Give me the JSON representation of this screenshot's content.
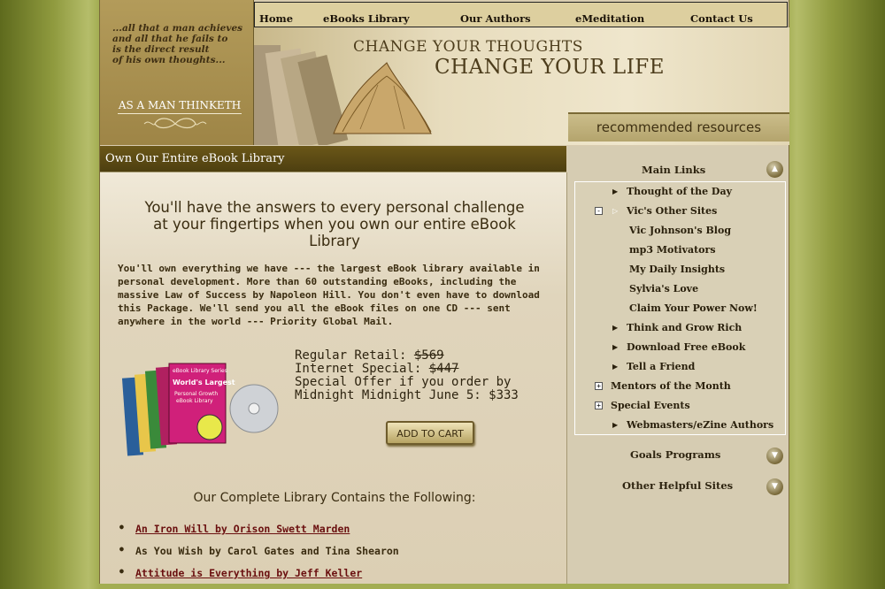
{
  "header": {
    "quote": "...all that a man achieves\nand all that he fails to\nis the direct result\nof his own thoughts...",
    "book_title": "AS A MAN THINKETH",
    "tagline_1": "CHANGE YOUR THOUGHTS",
    "tagline_2": "CHANGE YOUR LIFE",
    "recommended": "recommended resources"
  },
  "nav": {
    "home": "Home",
    "ebooks": "eBooks Library",
    "authors": "Our Authors",
    "emeditation": "eMeditation",
    "contact": "Contact Us"
  },
  "main": {
    "section_title": "Own Our Entire eBook Library",
    "headline": "You'll have the answers to every personal challenge at your fingertips when you own our entire eBook Library",
    "intro": "You'll own everything we have --- the largest eBook library available in personal development. More than 60 outstanding eBooks, including the massive Law of Success by Napoleon Hill. You don't even have to download this Package. We'll send you all the eBook files on one CD --- sent anywhere in the world --- Priority Global Mail.",
    "product_label": "World's Largest Personal Growth eBook Library",
    "product_series": "eBook Library Series",
    "regular_label": "Regular Retail: ",
    "regular_price": "$569",
    "internet_label": "Internet Special: ",
    "internet_price": "$447",
    "special_offer": "Special Offer if you order by Midnight Midnight June 5: $333",
    "add_to_cart": "ADD TO CART",
    "library_heading": "Our Complete Library Contains the Following:",
    "library_items": [
      "An Iron Will by Orison Swett Marden",
      "As You Wish by Carol Gates and Tina Shearon",
      "Attitude is Everything by Jeff Keller"
    ]
  },
  "sidebar": {
    "main_links": "Main Links",
    "thought": "Thought of the Day",
    "vics_sites": "Vic's Other Sites",
    "vic_blog": "Vic Johnson's Blog",
    "mp3": "mp3 Motivators",
    "insights": "My Daily Insights",
    "sylvia": "Sylvia's Love",
    "claim": "Claim Your Power Now!",
    "think_grow": "Think and Grow Rich",
    "download": "Download Free eBook",
    "tell": "Tell a Friend",
    "mentors": "Mentors of the Month",
    "events": "Special Events",
    "webmasters": "Webmasters/eZine Authors",
    "goals": "Goals Programs",
    "other": "Other Helpful Sites"
  },
  "colors": {
    "accent_dark": "#4d3f10",
    "link_red": "#6a0f0f",
    "olive_bg": "#8f9a3e"
  }
}
